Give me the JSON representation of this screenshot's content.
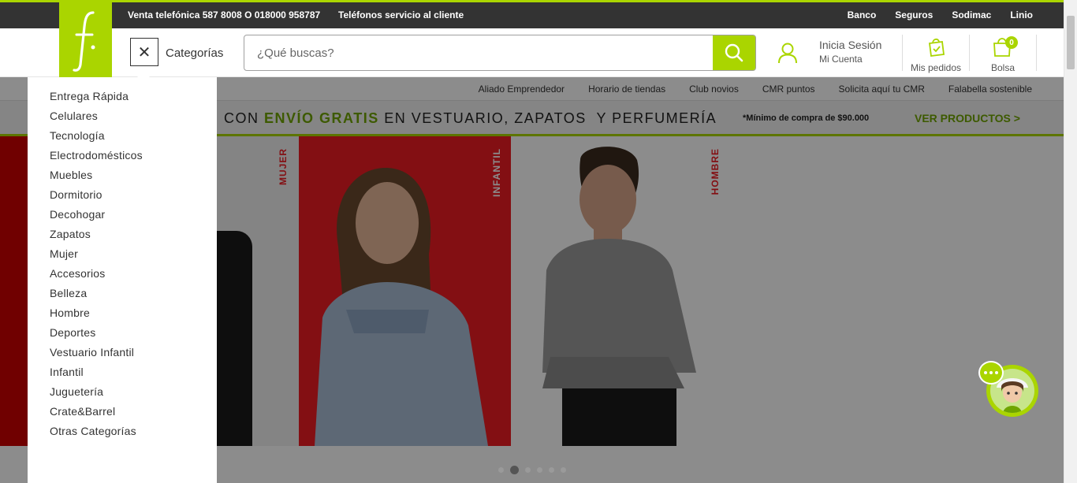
{
  "topbar": {
    "phone_sales": "Venta telefónica 587 8008 O 018000 958787",
    "customer_service": "Teléfonos servicio al cliente",
    "links": [
      "Banco",
      "Seguros",
      "Sodimac",
      "Linio"
    ]
  },
  "header": {
    "categories_label": "Categorías",
    "search_placeholder": "¿Qué buscas?",
    "login_title": "Inicia Sesión",
    "login_sub": "Mi Cuenta",
    "orders_label": "Mis pedidos",
    "bag_label": "Bolsa",
    "bag_count": "0"
  },
  "subnav": {
    "links": [
      "Aliado Emprendedor",
      "Horario de tiendas",
      "Club novios",
      "CMR puntos",
      "Solicita aquí tu CMR",
      "Falabella sostenible"
    ]
  },
  "promo": {
    "prefix": "CON",
    "highlight": "ENVÍO GRATIS",
    "suffix": "EN VESTUARIO, ZAPATOS  Y PERFUMERÍA",
    "note": "*Mínimo de compra de $90.000",
    "cta": "VER PRODUCTOS >"
  },
  "hero": {
    "labels": [
      "MUJER",
      "INFANTIL",
      "HOMBRE"
    ],
    "carousel_total": 6,
    "carousel_active": 2
  },
  "categories": [
    "Entrega Rápida",
    "Celulares",
    "Tecnología",
    "Electrodomésticos",
    "Muebles",
    "Dormitorio",
    "Decohogar",
    "Zapatos",
    "Mujer",
    "Accesorios",
    "Belleza",
    "Hombre",
    "Deportes",
    "Vestuario Infantil",
    "Infantil",
    "Juguetería",
    "Crate&Barrel",
    "Otras Categorías"
  ],
  "colors": {
    "brand_green": "#aad500",
    "dark_bar": "#333333",
    "promo_green": "#6fa400",
    "hero_red": "#ee1d23"
  }
}
